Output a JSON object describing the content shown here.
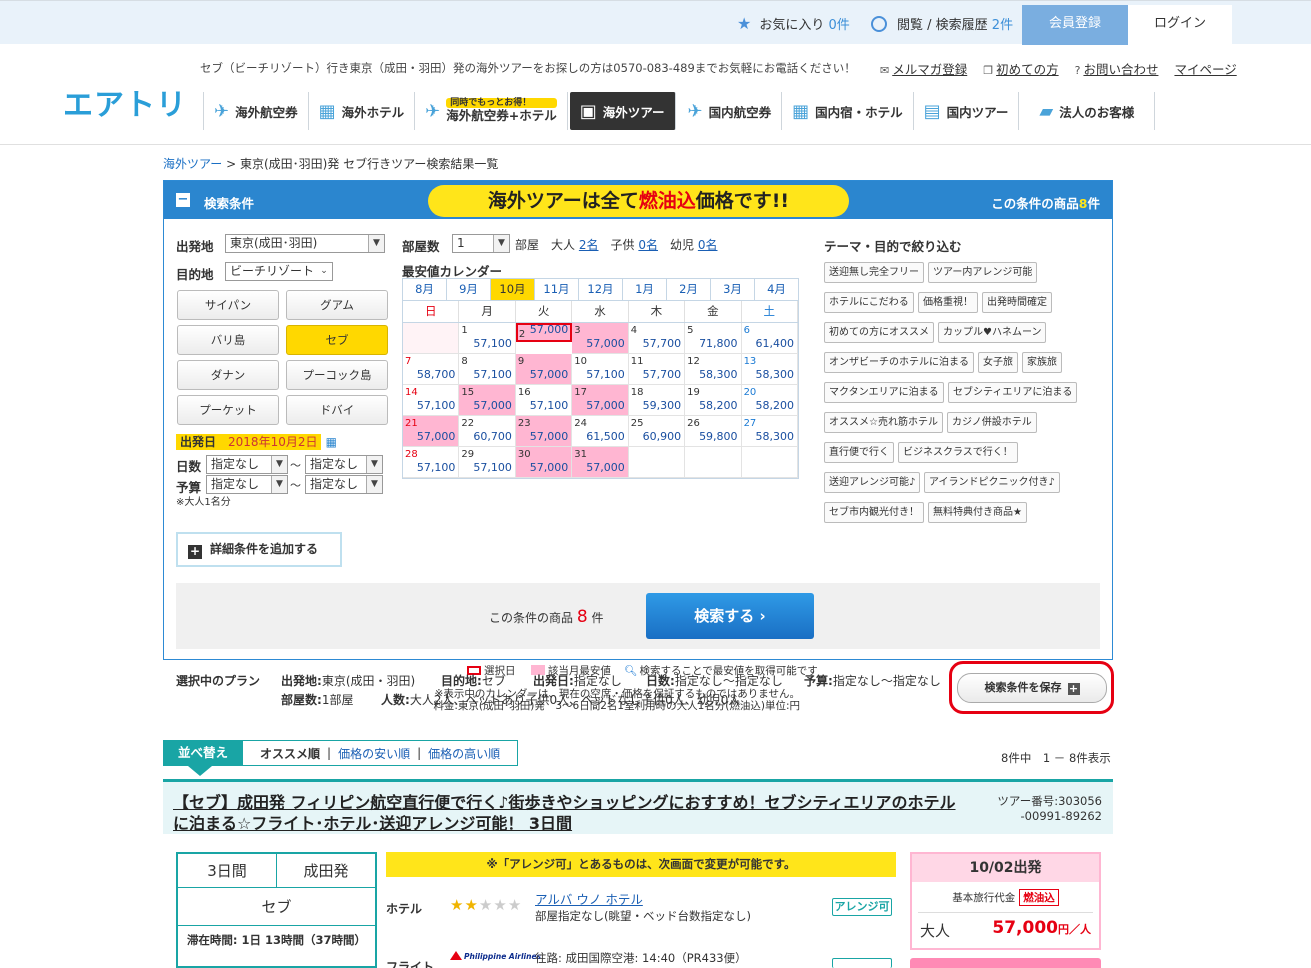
{
  "topbar": {
    "favorites_label": "お気に入り",
    "favorites_count": "0件",
    "history_label": "閲覧 / 検索履歴",
    "history_count": "2件",
    "register": "会員登録",
    "login": "ログイン"
  },
  "header": {
    "logo": "エアトリ",
    "message": "セブ（ビーチリゾート）行き東京（成田・羽田）発の海外ツアーをお探しの方は0570-083-489までお気軽にお電話ください！",
    "links": [
      "メルマガ登録",
      "初めての方",
      "お問い合わせ",
      "マイページ"
    ]
  },
  "gnav": {
    "items": [
      "海外航空券",
      "海外ホテル",
      "海外航空券+ホテル",
      "海外ツアー",
      "国内航空券",
      "国内宿・ホテル",
      "国内ツアー",
      "法人のお客様"
    ],
    "combo_badge": "同時でもっとお得！"
  },
  "breadcrumb": {
    "home": "海外ツアー",
    "current": " > 東京(成田･羽田)発 セブ行きツアー検索結果一覧"
  },
  "panel": {
    "title": "検索条件",
    "banner_pre": "海外ツアーは全て",
    "banner_red": "燃油込",
    "banner_post": "価格です!!",
    "count_label": "この条件の商品",
    "count_num": "8",
    "count_unit": "件"
  },
  "form": {
    "departure_label": "出発地",
    "departure_value": "東京(成田･羽田)",
    "destination_label": "目的地",
    "destination_value": "ビーチリゾート",
    "destinations": [
      "サイパン",
      "グアム",
      "バリ島",
      "セブ",
      "ダナン",
      "プーコック島",
      "プーケット",
      "ドバイ"
    ],
    "destination_selected": "セブ",
    "date_label": "出発日",
    "date_value": "2018年10月2日",
    "days_label": "日数",
    "budget_label": "予算",
    "unspecified": "指定なし",
    "tilde": "～",
    "note": "※大人1名分",
    "rooms_label": "部屋数",
    "rooms_value": "1",
    "room_unit": "部屋",
    "adult_label": "大人",
    "adult_value": "2名",
    "child_label": "子供",
    "child_value": "0名",
    "infant_label": "幼児",
    "infant_value": "0名",
    "detail_button": "詳細条件を追加する"
  },
  "calendar": {
    "title": "最安値カレンダー",
    "months": [
      "8月",
      "9月",
      "10月",
      "11月",
      "12月",
      "1月",
      "2月",
      "3月",
      "4月"
    ],
    "selected_month": "10月",
    "weekdays": [
      "日",
      "月",
      "火",
      "水",
      "木",
      "金",
      "土"
    ],
    "cells": [
      {
        "d": "",
        "p": ""
      },
      {
        "d": "1",
        "p": "57,100"
      },
      {
        "d": "2",
        "p": "57,000",
        "pink": true,
        "sel": true
      },
      {
        "d": "3",
        "p": "57,000",
        "pink": true
      },
      {
        "d": "4",
        "p": "57,700"
      },
      {
        "d": "5",
        "p": "71,800"
      },
      {
        "d": "6",
        "p": "61,400"
      },
      {
        "d": "7",
        "p": "58,700"
      },
      {
        "d": "8",
        "p": "57,100"
      },
      {
        "d": "9",
        "p": "57,000",
        "pink": true
      },
      {
        "d": "10",
        "p": "57,100"
      },
      {
        "d": "11",
        "p": "57,700"
      },
      {
        "d": "12",
        "p": "58,300"
      },
      {
        "d": "13",
        "p": "58,300"
      },
      {
        "d": "14",
        "p": "57,100"
      },
      {
        "d": "15",
        "p": "57,000",
        "pink": true
      },
      {
        "d": "16",
        "p": "57,100"
      },
      {
        "d": "17",
        "p": "57,000",
        "pink": true
      },
      {
        "d": "18",
        "p": "59,300"
      },
      {
        "d": "19",
        "p": "58,200"
      },
      {
        "d": "20",
        "p": "58,200"
      },
      {
        "d": "21",
        "p": "57,000",
        "pink": true
      },
      {
        "d": "22",
        "p": "60,700"
      },
      {
        "d": "23",
        "p": "57,000",
        "pink": true
      },
      {
        "d": "24",
        "p": "61,500"
      },
      {
        "d": "25",
        "p": "60,900"
      },
      {
        "d": "26",
        "p": "59,800"
      },
      {
        "d": "27",
        "p": "58,300"
      },
      {
        "d": "28",
        "p": "57,100"
      },
      {
        "d": "29",
        "p": "57,100"
      },
      {
        "d": "30",
        "p": "57,000",
        "pink": true
      },
      {
        "d": "31",
        "p": "57,000",
        "pink": true
      },
      {
        "d": "",
        "p": "",
        "blank": true
      },
      {
        "d": "",
        "p": "",
        "blank": true
      },
      {
        "d": "",
        "p": "",
        "blank": true
      }
    ],
    "legend_selected": "選択日",
    "legend_cheapest": "該当月最安値",
    "legend_search": "検索することで最安値を取得可能です",
    "note1": "※表示中のカレンダーは、現在の空席・価格を保証するものではありません。",
    "note2": "料金:東京(成田･羽田)発　3〜6日間2名1室利用時の大人1名分(燃油込)単位:円"
  },
  "themes": {
    "title": "テーマ・目的で絞り込む",
    "tags": [
      "送迎無し完全フリー",
      "ツアー内アレンジ可能",
      "ホテルにこだわる",
      "価格重視！",
      "出発時間確定",
      "初めての方にオススメ",
      "カップル♥ハネムーン",
      "オンザビーチのホテルに泊まる",
      "女子旅",
      "家族旅",
      "マクタンエリアに泊まる",
      "セブシティエリアに泊まる",
      "オススメ☆売れ筋ホテル",
      "カジノ併設ホテル",
      "直行便で行く",
      "ビジネスクラスで行く！",
      "送迎アレンジ可能♪",
      "アイランドピクニック付き♪",
      "セブ市内観光付き！",
      "無料特典付き商品★"
    ]
  },
  "search": {
    "count_label": "この条件の商品",
    "count_num": "8",
    "count_unit": "件",
    "button": "検索する"
  },
  "plan": {
    "title": "選択中のプラン",
    "departure": "東京(成田・羽田)",
    "destination": "セブ",
    "date": "指定なし",
    "days": "指定なし～指定なし",
    "budget": "指定なし～指定なし",
    "rooms": "1部屋",
    "people": "大人2人、ベッドあり子供0人、ベッドなし子供0人、幼児0人",
    "save_button": "検索条件を保存"
  },
  "sort": {
    "label": "並べ替え",
    "options": [
      "オススメ順",
      "価格の安い順",
      "価格の高い順"
    ],
    "result_text": "8件中　1 － 8件表示"
  },
  "card": {
    "title": "【セブ】成田発 フィリピン航空直行便で行く♪街歩きやショッピングにおすすめ！セブシティエリアのホテルに泊まる☆フライト･ホテル･送迎アレンジ可能！ 3日間",
    "tour_no_label": "ツアー番号:303056",
    "tour_no_sub": "-00991-89262",
    "days": "3日間",
    "from": "成田発",
    "dest": "セブ",
    "stay": "滞在時間: 1日 13時間（37時間）",
    "arrange_note": "※「アレンジ可」とあるものは、次画面で変更が可能です。",
    "hotel_label": "ホテル",
    "hotel_name": "アルバ ウノ ホテル",
    "hotel_sub": "部屋指定なし(眺望・ベッド台数指定なし)",
    "arrange_badge": "アレンジ可",
    "flight_label": "フライト",
    "airline": "Philippine Airlines",
    "flight_text": "往路: 成田国際空港: 14:40（PR433便）",
    "price_head": "10/02出発",
    "basic_label": "基本旅行代金",
    "fuel_label": "燃油込",
    "adult_label": "大人",
    "adult_price": "57,000",
    "price_unit": "円／人"
  }
}
